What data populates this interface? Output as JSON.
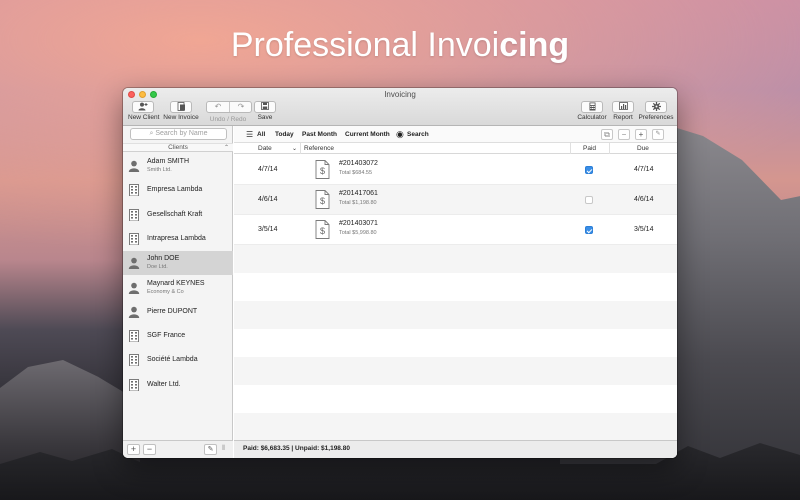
{
  "headline": {
    "part1": "Professional Invoi",
    "part2": "cing"
  },
  "window": {
    "title": "Invoicing"
  },
  "toolbar": {
    "new_client": "New Client",
    "new_invoice": "New Invoice",
    "undo_redo": "Undo / Redo",
    "save": "Save",
    "calculator": "Calculator",
    "report": "Report",
    "preferences": "Preferences"
  },
  "sidebar": {
    "search_placeholder": "Search by Name",
    "header": "Clients",
    "clients": [
      {
        "name": "Adam SMITH",
        "sub": "Smith Ltd.",
        "type": "person"
      },
      {
        "name": "Empresa Lambda",
        "sub": "",
        "type": "company"
      },
      {
        "name": "Gesellschaft Kraft",
        "sub": "",
        "type": "company"
      },
      {
        "name": "Intrapresa Lambda",
        "sub": "",
        "type": "company"
      },
      {
        "name": "John DOE",
        "sub": "Doe Ltd.",
        "type": "person",
        "selected": true
      },
      {
        "name": "Maynard KEYNES",
        "sub": "Economy & Co",
        "type": "person"
      },
      {
        "name": "Pierre DUPONT",
        "sub": "",
        "type": "person"
      },
      {
        "name": "SGF France",
        "sub": "",
        "type": "company"
      },
      {
        "name": "Société Lambda",
        "sub": "",
        "type": "company"
      },
      {
        "name": "Walter Ltd.",
        "sub": "",
        "type": "company"
      }
    ]
  },
  "filters": {
    "all": "All",
    "today": "Today",
    "past_month": "Past Month",
    "current_month": "Current Month",
    "search": "Search"
  },
  "columns": {
    "date": "Date",
    "reference": "Reference",
    "paid": "Paid",
    "due": "Due"
  },
  "invoices": [
    {
      "date": "4/7/14",
      "number": "#201403072",
      "total": "Total $684.55",
      "paid": true,
      "due": "4/7/14"
    },
    {
      "date": "4/6/14",
      "number": "#201417061",
      "total": "Total $1,198.80",
      "paid": false,
      "due": "4/6/14"
    },
    {
      "date": "3/5/14",
      "number": "#201403071",
      "total": "Total $5,998.80",
      "paid": true,
      "due": "3/5/14"
    }
  ],
  "status": {
    "text": "Paid: $6,683.35 | Unpaid: $1,198.80"
  },
  "colors": {
    "accent": "#3a8ee6",
    "selection": "#d4d4d4"
  }
}
